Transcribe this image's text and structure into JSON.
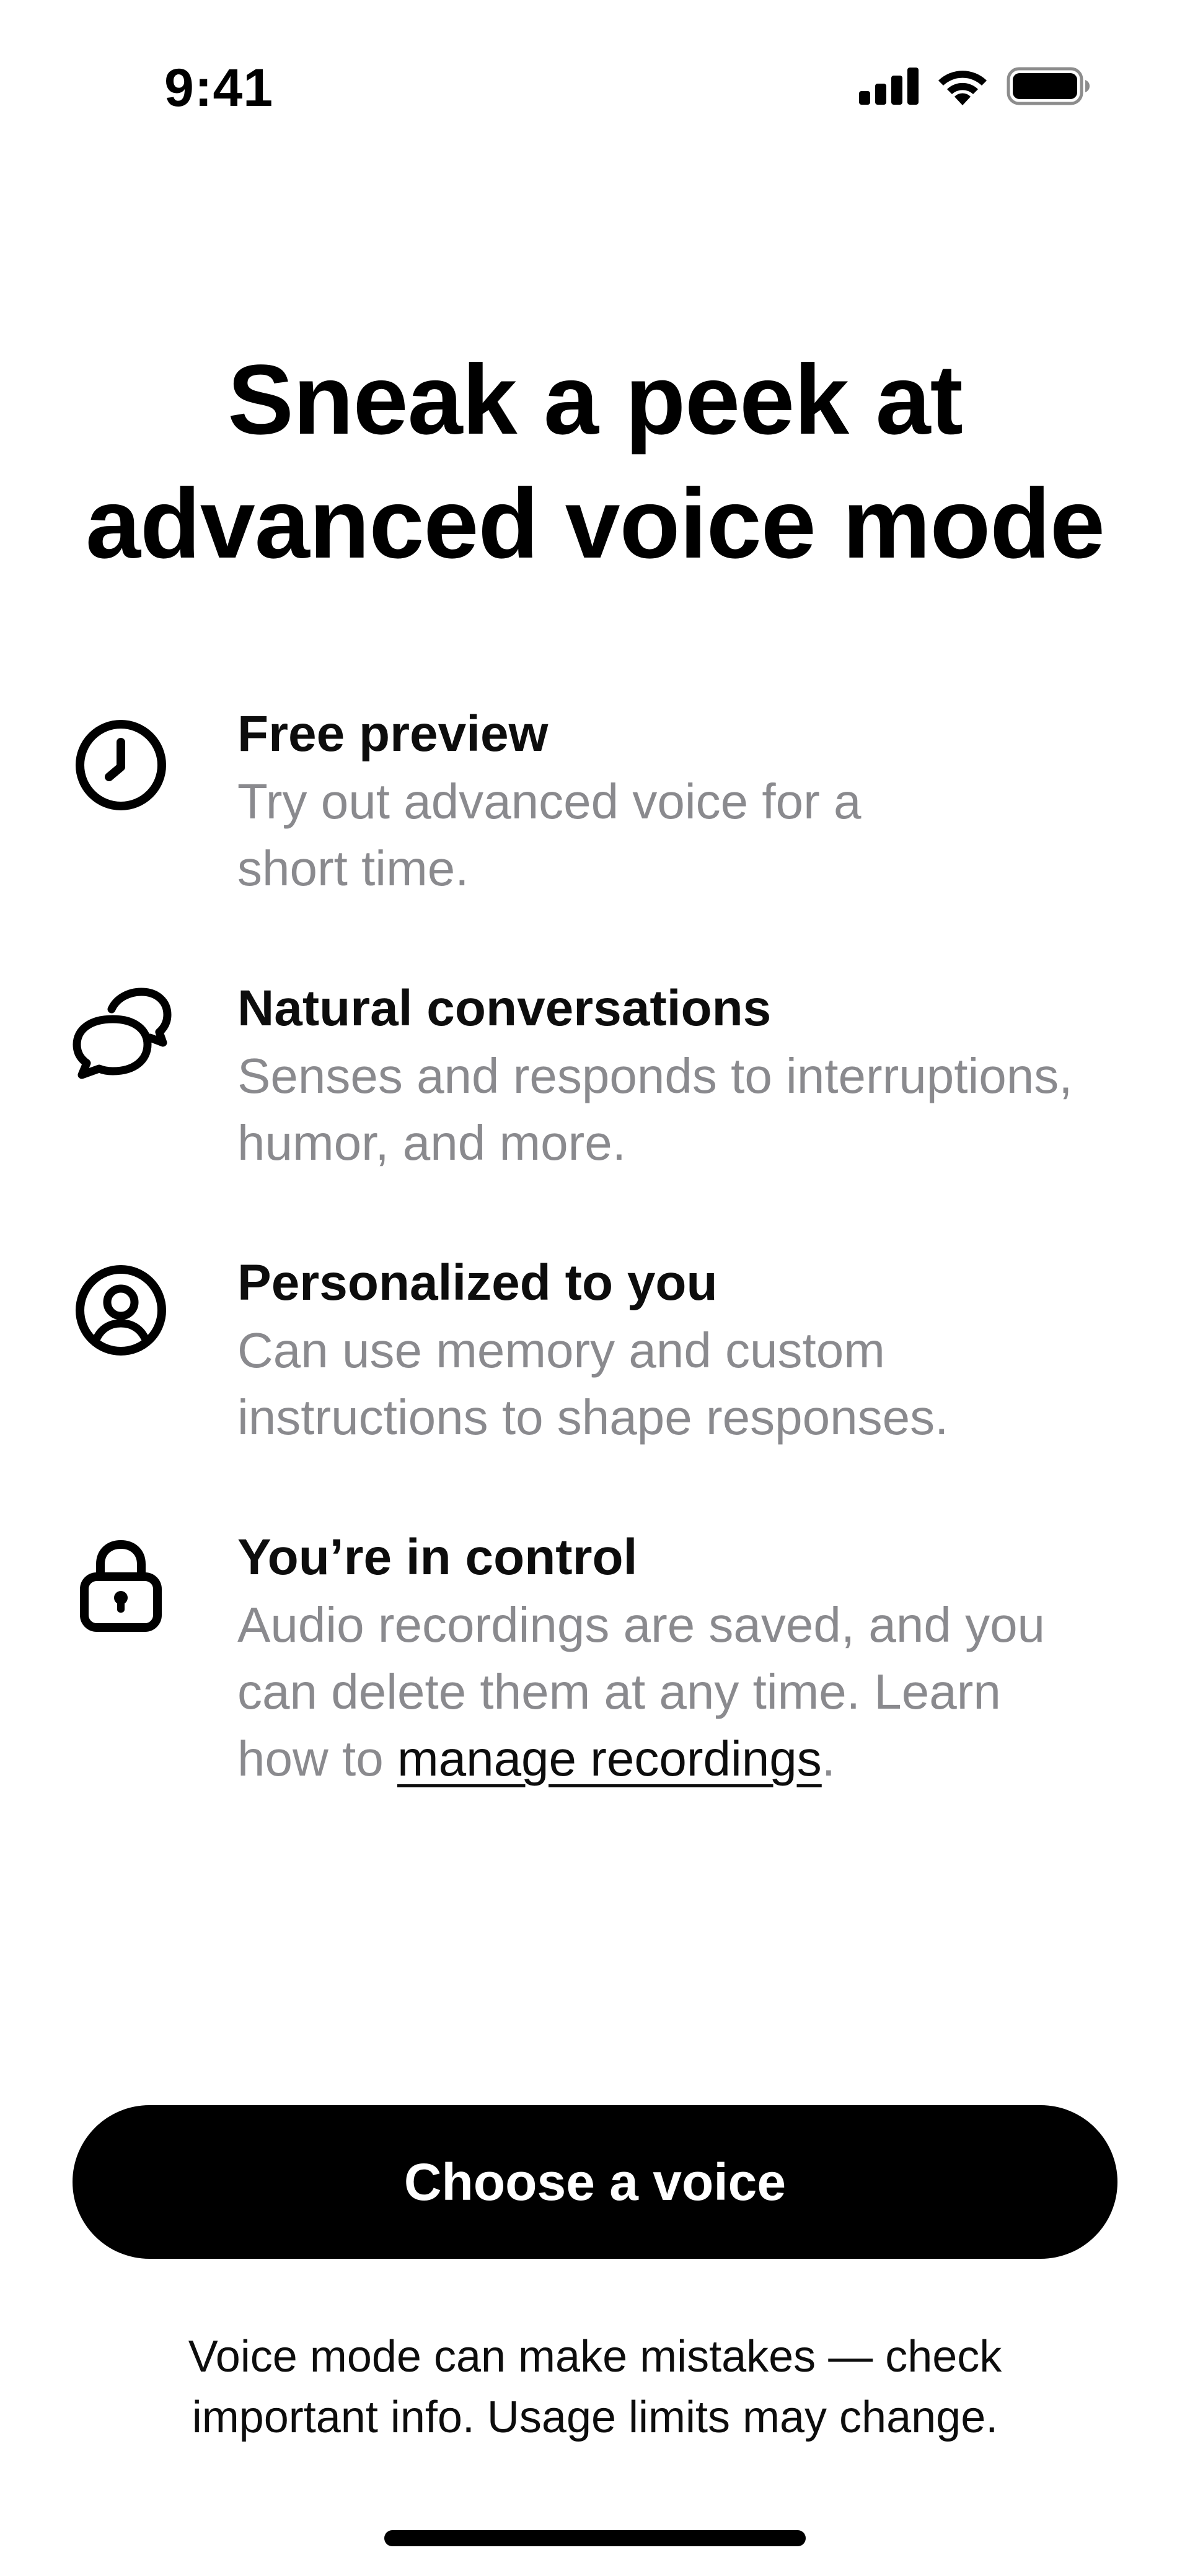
{
  "status_bar": {
    "time": "9:41",
    "icons": [
      "cellular-signal-icon",
      "wifi-icon",
      "battery-icon"
    ]
  },
  "title": {
    "line1": "Sneak a peek at",
    "line2": "advanced voice mode"
  },
  "features": [
    {
      "icon": "clock-icon",
      "title": "Free preview",
      "line1": "Try out advanced voice for a",
      "line2": "short time."
    },
    {
      "icon": "chat-bubbles-icon",
      "title": "Natural conversations",
      "line1": "Senses and responds to interruptions,",
      "line2": "humor, and more."
    },
    {
      "icon": "user-circle-icon",
      "title": "Personalized to you",
      "line1": "Can use memory and custom",
      "line2": "instructions to shape responses."
    },
    {
      "icon": "lock-icon",
      "title": "You’re in control",
      "line1": "Audio recordings are saved, and you",
      "line2": "can delete them at any time. Learn",
      "line3_prefix": "how to ",
      "link_text": "manage recordings",
      "line3_suffix": "."
    }
  ],
  "cta": {
    "label": "Choose a voice"
  },
  "disclaimer": {
    "line1": "Voice mode can make mistakes — check",
    "line2": "important info. Usage limits may change."
  },
  "colors": {
    "primary_text": "#0d0d0d",
    "secondary_text": "#8a8a8e",
    "button_bg": "#000000",
    "button_text": "#ffffff",
    "background": "#ffffff"
  }
}
